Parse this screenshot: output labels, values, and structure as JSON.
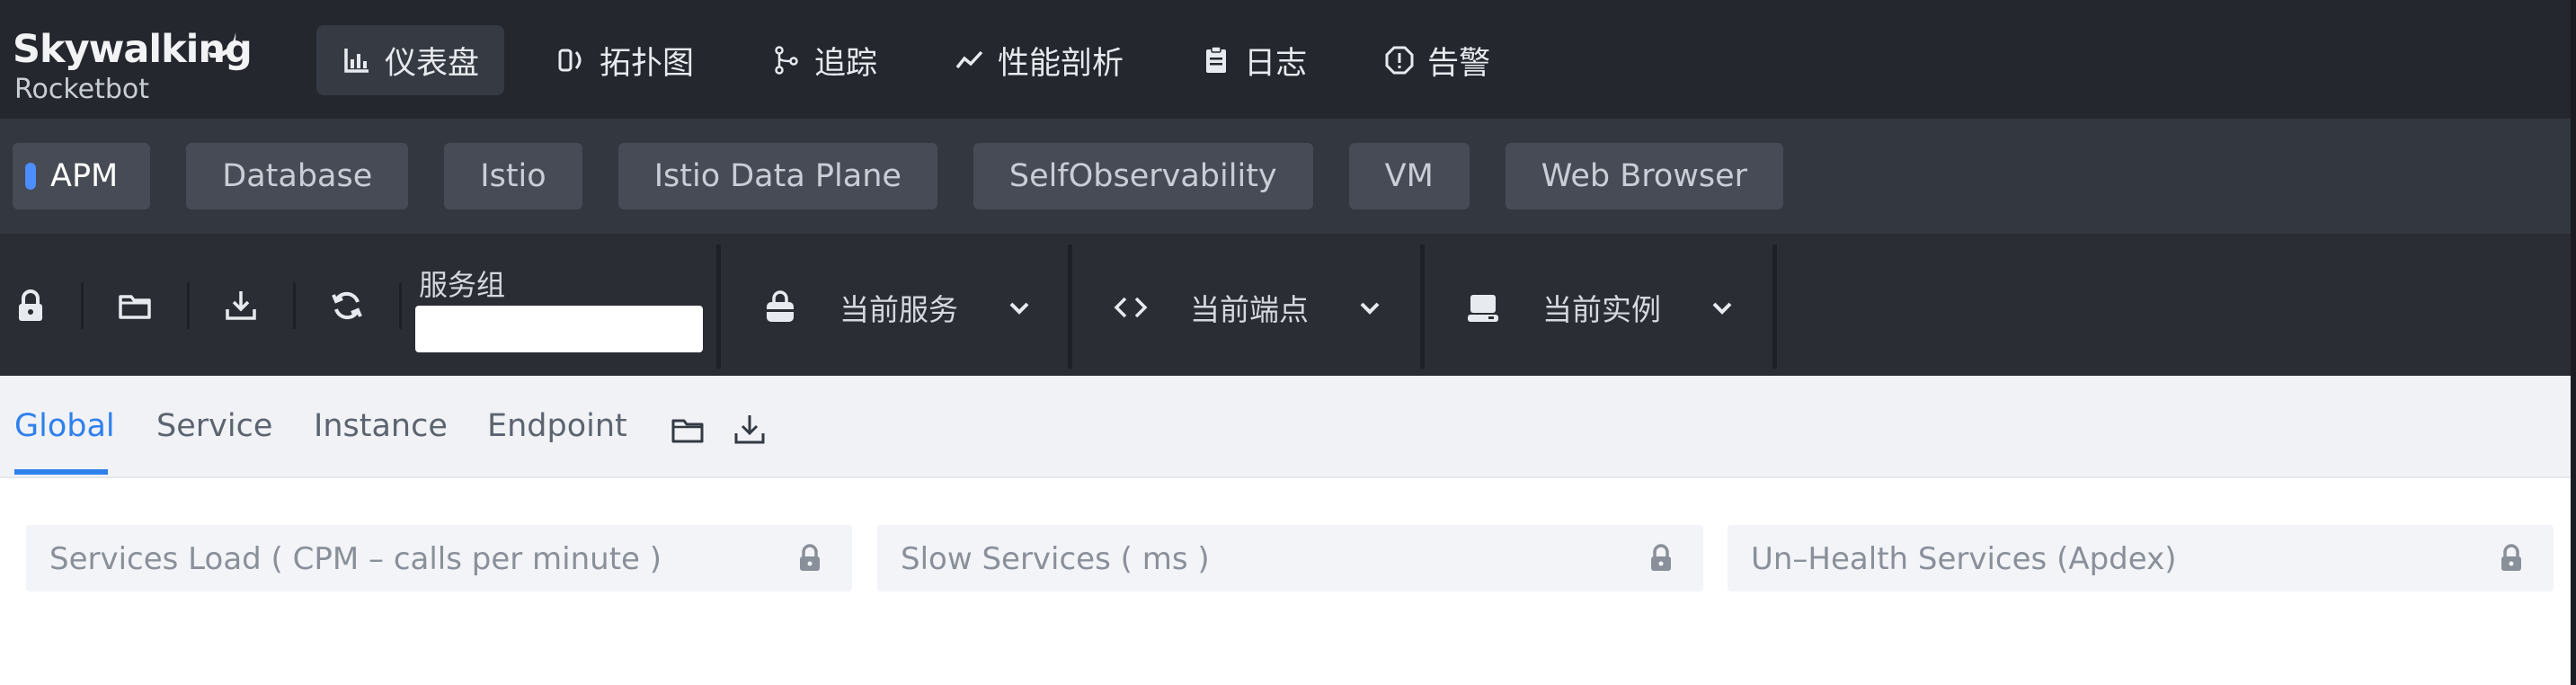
{
  "brand": {
    "name": "Skywalking",
    "subtitle": "Rocketbot"
  },
  "nav": [
    {
      "label": "仪表盘",
      "icon": "dashboard-chart-icon",
      "active": true
    },
    {
      "label": "拓扑图",
      "icon": "topology-icon",
      "active": false
    },
    {
      "label": "追踪",
      "icon": "trace-branch-icon",
      "active": false
    },
    {
      "label": "性能剖析",
      "icon": "profiling-line-icon",
      "active": false
    },
    {
      "label": "日志",
      "icon": "log-clipboard-icon",
      "active": false
    },
    {
      "label": "告警",
      "icon": "alarm-octagon-icon",
      "active": false
    }
  ],
  "layers": [
    {
      "label": "APM",
      "active": true
    },
    {
      "label": "Database",
      "active": false
    },
    {
      "label": "Istio",
      "active": false
    },
    {
      "label": "Istio Data Plane",
      "active": false
    },
    {
      "label": "SelfObservability",
      "active": false
    },
    {
      "label": "VM",
      "active": false
    },
    {
      "label": "Web Browser",
      "active": false
    }
  ],
  "toolbar": {
    "icons": [
      "lock-icon",
      "folder-icon",
      "download-icon",
      "refresh-icon"
    ],
    "service_group_label": "服务组",
    "service_group_value": "",
    "current_service": "当前服务",
    "current_endpoint": "当前端点",
    "current_instance": "当前实例"
  },
  "dashboard_tabs": [
    {
      "label": "Global",
      "active": true
    },
    {
      "label": "Service",
      "active": false
    },
    {
      "label": "Instance",
      "active": false
    },
    {
      "label": "Endpoint",
      "active": false
    }
  ],
  "panels": [
    {
      "title": "Services Load ( CPM – calls per minute )"
    },
    {
      "title": "Slow Services ( ms )"
    },
    {
      "title": "Un–Health Services (Apdex)"
    }
  ],
  "colors": {
    "accent": "#2f80ed",
    "header_bg": "#24272d",
    "layer_dot": "#4d8eff"
  }
}
